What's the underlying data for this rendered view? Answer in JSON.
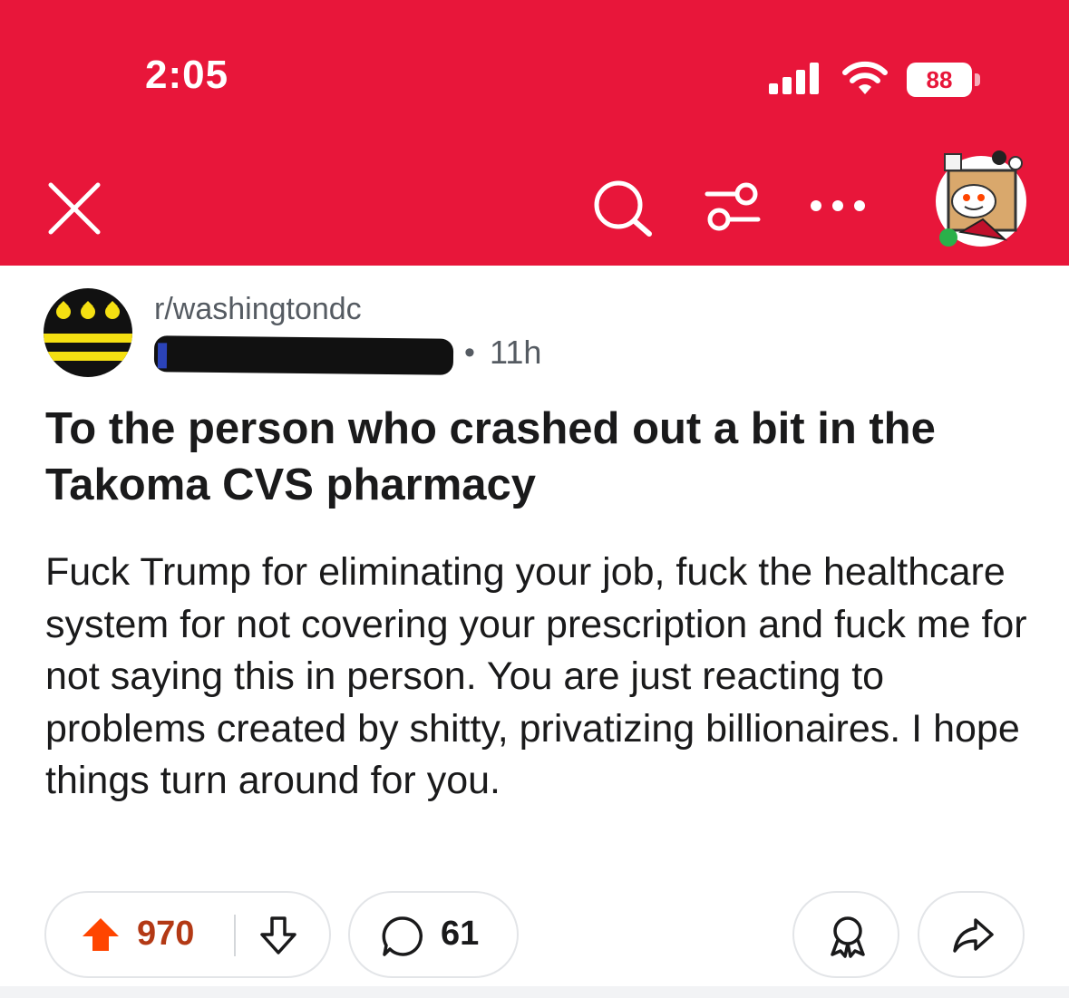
{
  "status_bar": {
    "time": "2:05",
    "battery": "88",
    "icons": [
      "signal-icon",
      "wifi-icon",
      "battery-icon"
    ]
  },
  "header": {
    "background": "#e8163a",
    "icons": [
      "close-icon",
      "search-icon",
      "filter-icon",
      "more-icon",
      "avatar"
    ]
  },
  "post": {
    "subreddit": "r/washingtondc",
    "separator": "•",
    "age": "11h",
    "title": "To the person who crashed out a bit in the Takoma CVS pharmacy",
    "body": "Fuck Trump for eliminating your job, fuck the healthcare system for not covering your prescription and fuck me for not saying this in person. You are just reacting to problems created by shitty, privatizing billionaires. I hope things turn around for you."
  },
  "actions": {
    "upvotes": "970",
    "comments": "61",
    "upvote_color": "#ff4500",
    "icons": [
      "upvote-icon",
      "downvote-icon",
      "comment-icon",
      "award-icon",
      "share-icon"
    ]
  }
}
